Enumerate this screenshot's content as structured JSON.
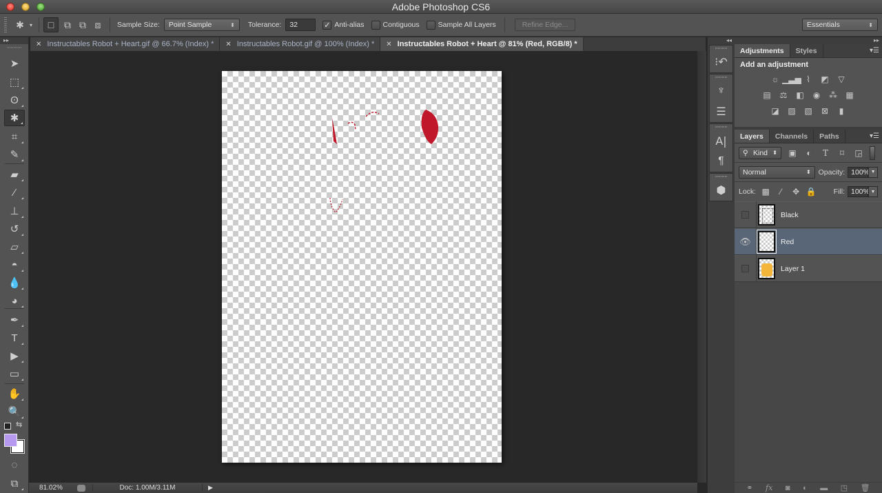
{
  "window": {
    "title": "Adobe Photoshop CS6"
  },
  "options_bar": {
    "tool": "magic-wand",
    "sample_size_label": "Sample Size:",
    "sample_size_value": "Point Sample",
    "tolerance_label": "Tolerance:",
    "tolerance_value": "32",
    "anti_alias_label": "Anti-alias",
    "anti_alias_checked": true,
    "contiguous_label": "Contiguous",
    "contiguous_checked": false,
    "sample_all_layers_label": "Sample All Layers",
    "sample_all_layers_checked": false,
    "refine_edge_label": "Refine Edge...",
    "workspace_value": "Essentials",
    "selection_modes": [
      "new-selection",
      "add-to-selection",
      "subtract-from-selection",
      "intersect-with-selection"
    ]
  },
  "document_tabs": [
    {
      "label": "Instructables Robot + Heart.gif @ 66.7% (Index) *",
      "active": false
    },
    {
      "label": "Instructables Robot.gif @ 100% (Index) *",
      "active": false
    },
    {
      "label": "Instructables Robot + Heart @ 81% (Red, RGB/8) *",
      "active": true
    }
  ],
  "tools": [
    {
      "name": "move-tool",
      "glyph": "➤"
    },
    {
      "name": "rectangular-marquee-tool",
      "glyph": "⬚"
    },
    {
      "name": "lasso-tool",
      "glyph": "ʘ"
    },
    {
      "name": "magic-wand-tool",
      "glyph": "✱",
      "active": true
    },
    {
      "name": "crop-tool",
      "glyph": "⌗"
    },
    {
      "name": "eyedropper-tool",
      "glyph": "✎"
    },
    {
      "name": "healing-brush-tool",
      "glyph": "▰"
    },
    {
      "name": "brush-tool",
      "glyph": "⁄"
    },
    {
      "name": "clone-stamp-tool",
      "glyph": "⊥"
    },
    {
      "name": "history-brush-tool",
      "glyph": "↺"
    },
    {
      "name": "eraser-tool",
      "glyph": "▱"
    },
    {
      "name": "paint-bucket-tool",
      "glyph": "◓"
    },
    {
      "name": "blur-tool",
      "glyph": "💧"
    },
    {
      "name": "dodge-tool",
      "glyph": "◕"
    },
    {
      "name": "pen-tool",
      "glyph": "✒"
    },
    {
      "name": "type-tool",
      "glyph": "T"
    },
    {
      "name": "path-selection-tool",
      "glyph": "▶"
    },
    {
      "name": "rectangle-shape-tool",
      "glyph": "▭"
    },
    {
      "name": "hand-tool",
      "glyph": "✋"
    },
    {
      "name": "zoom-tool",
      "glyph": "🔍"
    }
  ],
  "colors": {
    "foreground": "#b899f0",
    "background": "#ffffff",
    "selection_red": "#c0182a",
    "selected_layer_bg": "#596678"
  },
  "status_bar": {
    "zoom": "81.02%",
    "doc_info": "Doc: 1.00M/3.11M"
  },
  "adjustments_panel": {
    "tabs": [
      {
        "label": "Adjustments",
        "active": true
      },
      {
        "label": "Styles",
        "active": false
      }
    ],
    "heading": "Add an adjustment",
    "rows": [
      [
        "brightness-contrast",
        "levels",
        "curves",
        "exposure",
        "vibrance"
      ],
      [
        "hue-saturation",
        "color-balance",
        "black-white",
        "photo-filter",
        "channel-mixer",
        "color-lookup"
      ],
      [
        "invert",
        "posterize",
        "threshold",
        "selective-color",
        "gradient-map"
      ]
    ]
  },
  "layers_panel": {
    "tabs": [
      {
        "label": "Layers",
        "active": true
      },
      {
        "label": "Channels",
        "active": false
      },
      {
        "label": "Paths",
        "active": false
      }
    ],
    "filter_label": "Kind",
    "blend_mode": "Normal",
    "opacity_label": "Opacity:",
    "opacity_value": "100%",
    "lock_label": "Lock:",
    "fill_label": "Fill:",
    "fill_value": "100%",
    "layers": [
      {
        "name": "Black",
        "visible": false,
        "selected": false,
        "thumb": "black"
      },
      {
        "name": "Red",
        "visible": true,
        "selected": true,
        "thumb": "red"
      },
      {
        "name": "Layer 1",
        "visible": false,
        "selected": false,
        "thumb": "robot"
      }
    ],
    "footer_icons": [
      "link-layers",
      "add-layer-style",
      "add-layer-mask",
      "new-adjustment-layer",
      "new-group",
      "new-layer",
      "delete-layer"
    ]
  },
  "dock_icons": [
    "history",
    "brush-presets",
    "brush",
    "character",
    "paragraph",
    "3d"
  ]
}
